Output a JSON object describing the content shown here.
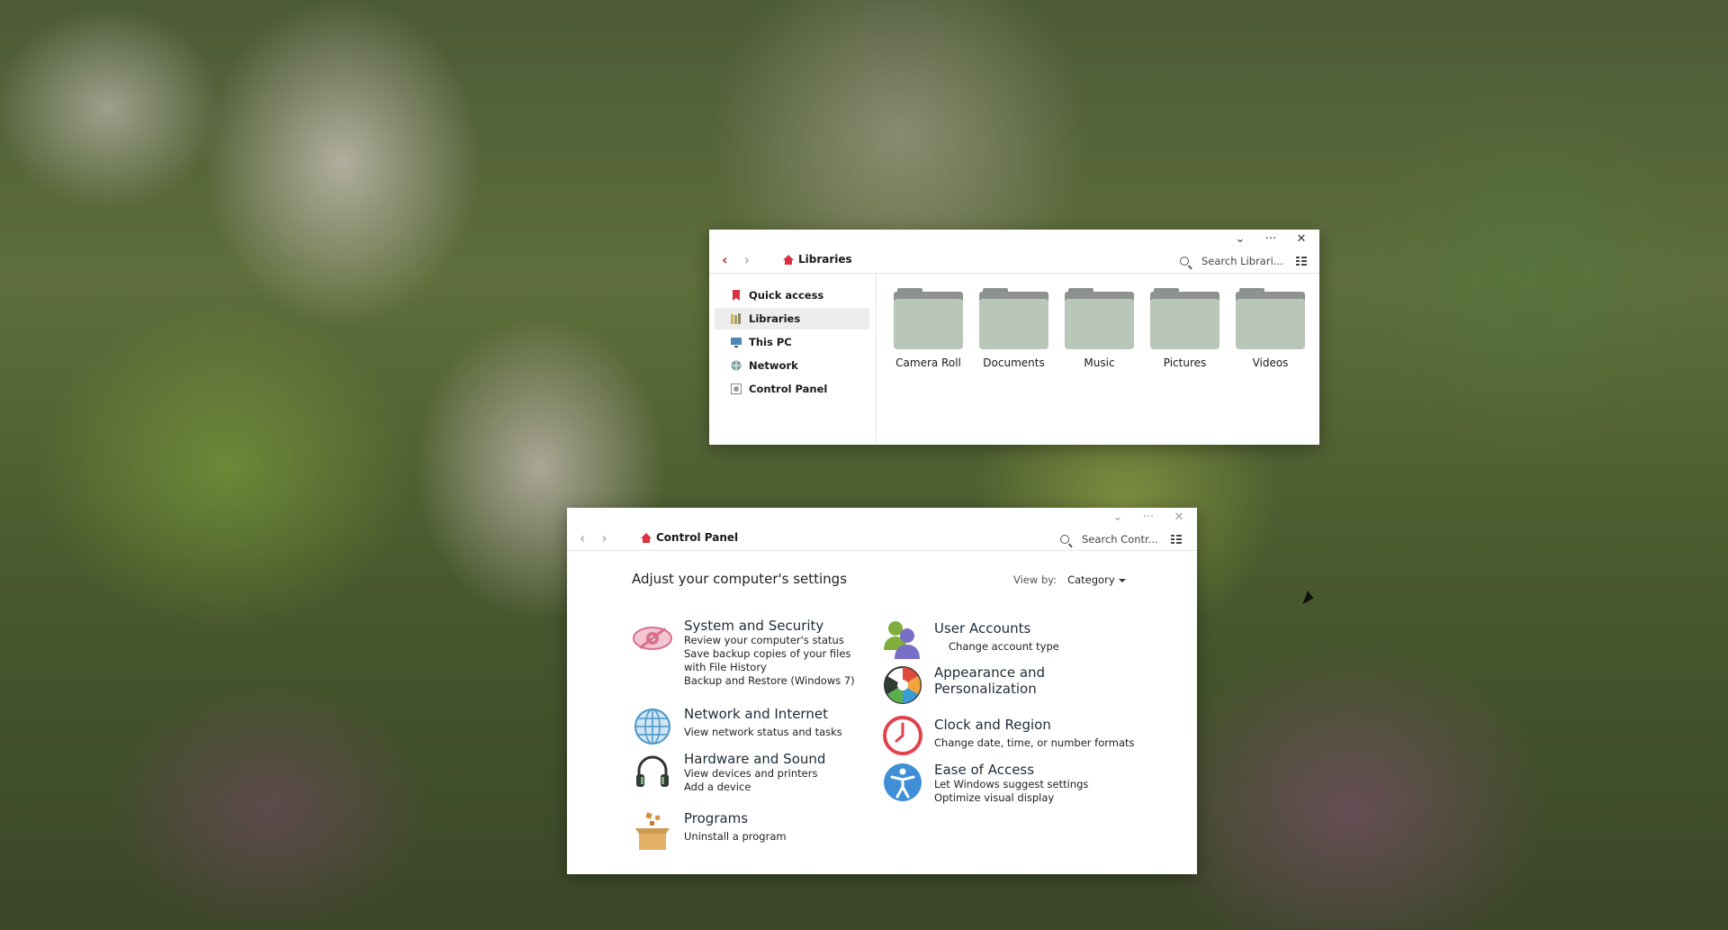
{
  "libraries_window": {
    "title_controls": {
      "collapse": "⌄",
      "more": "···",
      "close": "✕"
    },
    "nav": {
      "back": "‹",
      "forward": "›"
    },
    "address": "Libraries",
    "search_placeholder": "Search Librari...",
    "sidebar": [
      {
        "label": "Quick access",
        "icon": "bookmark-icon"
      },
      {
        "label": "Libraries",
        "icon": "libraries-icon"
      },
      {
        "label": "This PC",
        "icon": "monitor-icon"
      },
      {
        "label": "Network",
        "icon": "network-icon"
      },
      {
        "label": "Control Panel",
        "icon": "control-panel-icon"
      }
    ],
    "folders": [
      "Camera Roll",
      "Documents",
      "Music",
      "Pictures",
      "Videos"
    ]
  },
  "control_panel_window": {
    "title_controls": {
      "collapse": "⌄",
      "more": "···",
      "close": "✕"
    },
    "nav": {
      "back": "‹",
      "forward": "›"
    },
    "address": "Control Panel",
    "search_placeholder": "Search Contr...",
    "heading": "Adjust your computer's settings",
    "view_by_label": "View by:",
    "view_by_value": "Category",
    "categories_left": [
      {
        "title": "System and Security",
        "icon": "shield-eye-icon",
        "links": [
          "Review your computer's status",
          "Save backup copies of your files with File History",
          "Backup and Restore (Windows 7)"
        ]
      },
      {
        "title": "Network and Internet",
        "icon": "globe-icon",
        "links": [
          "View network status and tasks"
        ]
      },
      {
        "title": "Hardware and Sound",
        "icon": "headphones-icon",
        "links": [
          "View devices and printers",
          "Add a device"
        ]
      },
      {
        "title": "Programs",
        "icon": "package-icon",
        "links": [
          "Uninstall a program"
        ]
      }
    ],
    "categories_right": [
      {
        "title": "User Accounts",
        "icon": "users-icon",
        "links": [
          "Change account type"
        ]
      },
      {
        "title_line1": "Appearance and",
        "title_line2": "Personalization",
        "icon": "palette-icon"
      },
      {
        "title": "Clock and Region",
        "icon": "clock-icon",
        "links": [
          "Change date, time, or number formats"
        ]
      },
      {
        "title": "Ease of Access",
        "icon": "accessibility-icon",
        "links": [
          "Let Windows suggest settings",
          "Optimize visual display"
        ]
      }
    ]
  },
  "colors": {
    "accent_red": "#d9333f",
    "folder_front": "#b9c7b8",
    "folder_back": "#8f9390"
  }
}
